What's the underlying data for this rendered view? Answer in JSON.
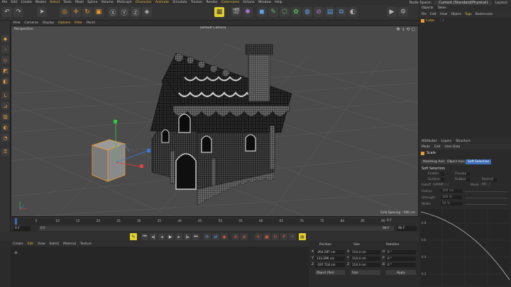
{
  "menubar": {
    "items": [
      "File",
      "Edit",
      "Create",
      "Modes",
      "Select",
      "Tools",
      "Mesh",
      "Spline",
      "Volume",
      "MoGraph",
      "Character",
      "Animate",
      "Simulate",
      "Tracker",
      "Render",
      "Extensions",
      "Octane",
      "Window",
      "Help"
    ],
    "highlighted": [
      "Select",
      "Character",
      "Animate",
      "Extensions"
    ],
    "node_space_label": "Node Space:",
    "node_space_value": "Current (Standard/Physical)",
    "layout_label": "Layout:"
  },
  "viewport": {
    "menu": [
      "View",
      "Cameras",
      "Display",
      "Options",
      "Filter",
      "Panel"
    ],
    "menu_highlighted": [
      "Options",
      "Filter"
    ],
    "label": "Perspective",
    "camera": "Default Camera",
    "grid_spacing": "Grid Spacing : 500 cm"
  },
  "timeline": {
    "ticks": [
      "0",
      "5",
      "10",
      "15",
      "20",
      "25",
      "30",
      "35",
      "40",
      "45",
      "50",
      "55",
      "60",
      "65",
      "70",
      "75",
      "80",
      "85",
      "90"
    ],
    "frame_end_right": "0 F",
    "start_field": "0 F",
    "current_field": "0 F",
    "end_field": "90 F",
    "end_field2": "90 F"
  },
  "materials": {
    "menu": [
      "Create",
      "Edit",
      "View",
      "Select",
      "Material",
      "Texture"
    ],
    "menu_highlighted": [
      "Edit"
    ],
    "add_label": "+"
  },
  "coordinates": {
    "headers": [
      "Position",
      "Size",
      "Rotation"
    ],
    "rows": [
      {
        "axis": "X",
        "pos": "-264.287 cm",
        "size_axis": "X",
        "size": "114.4 cm",
        "rot_axis": "H",
        "rot": "0 °"
      },
      {
        "axis": "Y",
        "pos": "133.296 cm",
        "size_axis": "Y",
        "size": "114.4 cm",
        "rot_axis": "P",
        "rot": "0 °"
      },
      {
        "axis": "Z",
        "pos": "-197.718 cm",
        "size_axis": "Z",
        "size": "114.4 cm",
        "rot_axis": "B",
        "rot": "0 °"
      }
    ],
    "mode_select": "Object (Rel)",
    "size_select": "Size",
    "apply": "Apply"
  },
  "right_panel": {
    "tabs": [
      "Objects",
      "Takes"
    ],
    "menu": [
      "File",
      "Edit",
      "View",
      "Object",
      "Tags",
      "Bookmarks"
    ],
    "menu_highlighted": [
      "Tags"
    ],
    "objects": [
      {
        "name": "Cube"
      }
    ]
  },
  "attributes": {
    "tabs": [
      "Attributes",
      "Layers",
      "Structure"
    ],
    "menu": [
      "Mode",
      "Edit",
      "User Data"
    ],
    "object_name": "Scale",
    "subtabs": [
      "Modeling Axis",
      "Object Axis",
      "Soft Selection"
    ],
    "active_subtab": "Soft Selection",
    "section": "Soft Selection",
    "fields": {
      "enable": "Enable",
      "preview": "Preview",
      "surface": "Surface",
      "rubber": "Rubber",
      "restrict": "Restrict",
      "falloff": "Falloff",
      "falloff_value": "Linear",
      "mode": "Mode",
      "mode_value": "All",
      "radius": "Radius",
      "radius_value": "100 cm",
      "strength": "Strength",
      "strength_value": "100 %",
      "width": "Width",
      "width_value": "50 %"
    },
    "graph_ticks_y": [
      "0.8",
      "0.6",
      "0.4",
      "0.2"
    ]
  },
  "colors": {
    "accent": "#e8b83a",
    "selection_blue": "#3d6fb8",
    "orange_tool": "#f09a2a"
  }
}
